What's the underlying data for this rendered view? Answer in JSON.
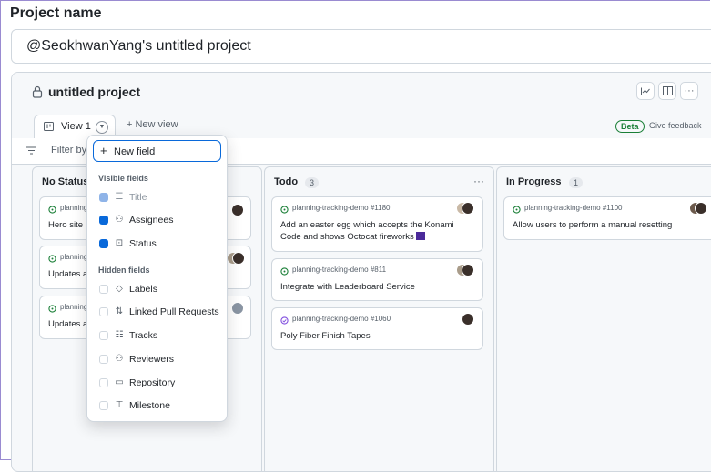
{
  "project": {
    "label": "Project name",
    "name_value": "@SeokhwanYang's untitled project"
  },
  "header": {
    "title": "untitled project",
    "tools": [
      "insights-icon",
      "layout-icon",
      "more-icon"
    ]
  },
  "tabs": {
    "view_label": "View 1",
    "new_view": "+ New view",
    "beta": "Beta",
    "feedback": "Give feedback"
  },
  "filter": {
    "placeholder": "Filter by"
  },
  "columns": [
    {
      "title": "No Status",
      "count": "",
      "items": [
        {
          "ref": "planning-tracking-demo",
          "title": "Hero site"
        },
        {
          "ref": "planning-tracking-demo",
          "title": "Updates a"
        },
        {
          "ref": "planning-tracking-demo",
          "title": "Updates a"
        }
      ]
    },
    {
      "title": "Todo",
      "count": "3",
      "items": [
        {
          "ref": "planning-tracking-demo #1180",
          "title": "Add an easter egg which accepts the Konami Code and shows Octocat fireworks"
        },
        {
          "ref": "planning-tracking-demo #811",
          "title": "Integrate with Leaderboard Service"
        },
        {
          "ref": "planning-tracking-demo #1060",
          "title": "Poly Fiber Finish Tapes"
        }
      ]
    },
    {
      "title": "In Progress",
      "count": "1",
      "items": [
        {
          "ref": "planning-tracking-demo #1100",
          "title": "Allow users to perform a manual resetting"
        }
      ]
    }
  ],
  "menu": {
    "new_field": "New field",
    "visible_heading": "Visible fields",
    "hidden_heading": "Hidden fields",
    "visible": [
      {
        "label": "Title",
        "icon": "title-icon"
      },
      {
        "label": "Assignees",
        "icon": "people-icon"
      },
      {
        "label": "Status",
        "icon": "single-select-icon"
      }
    ],
    "hidden": [
      {
        "label": "Labels",
        "icon": "tag-icon"
      },
      {
        "label": "Linked Pull Requests",
        "icon": "pull-request-icon"
      },
      {
        "label": "Tracks",
        "icon": "tasklist-icon"
      },
      {
        "label": "Reviewers",
        "icon": "people-icon"
      },
      {
        "label": "Repository",
        "icon": "repo-icon"
      },
      {
        "label": "Milestone",
        "icon": "milestone-icon"
      }
    ]
  },
  "colors": {
    "accent": "#0969da",
    "success": "#1a7f37",
    "done": "#8250df",
    "border": "#d0d7de"
  }
}
